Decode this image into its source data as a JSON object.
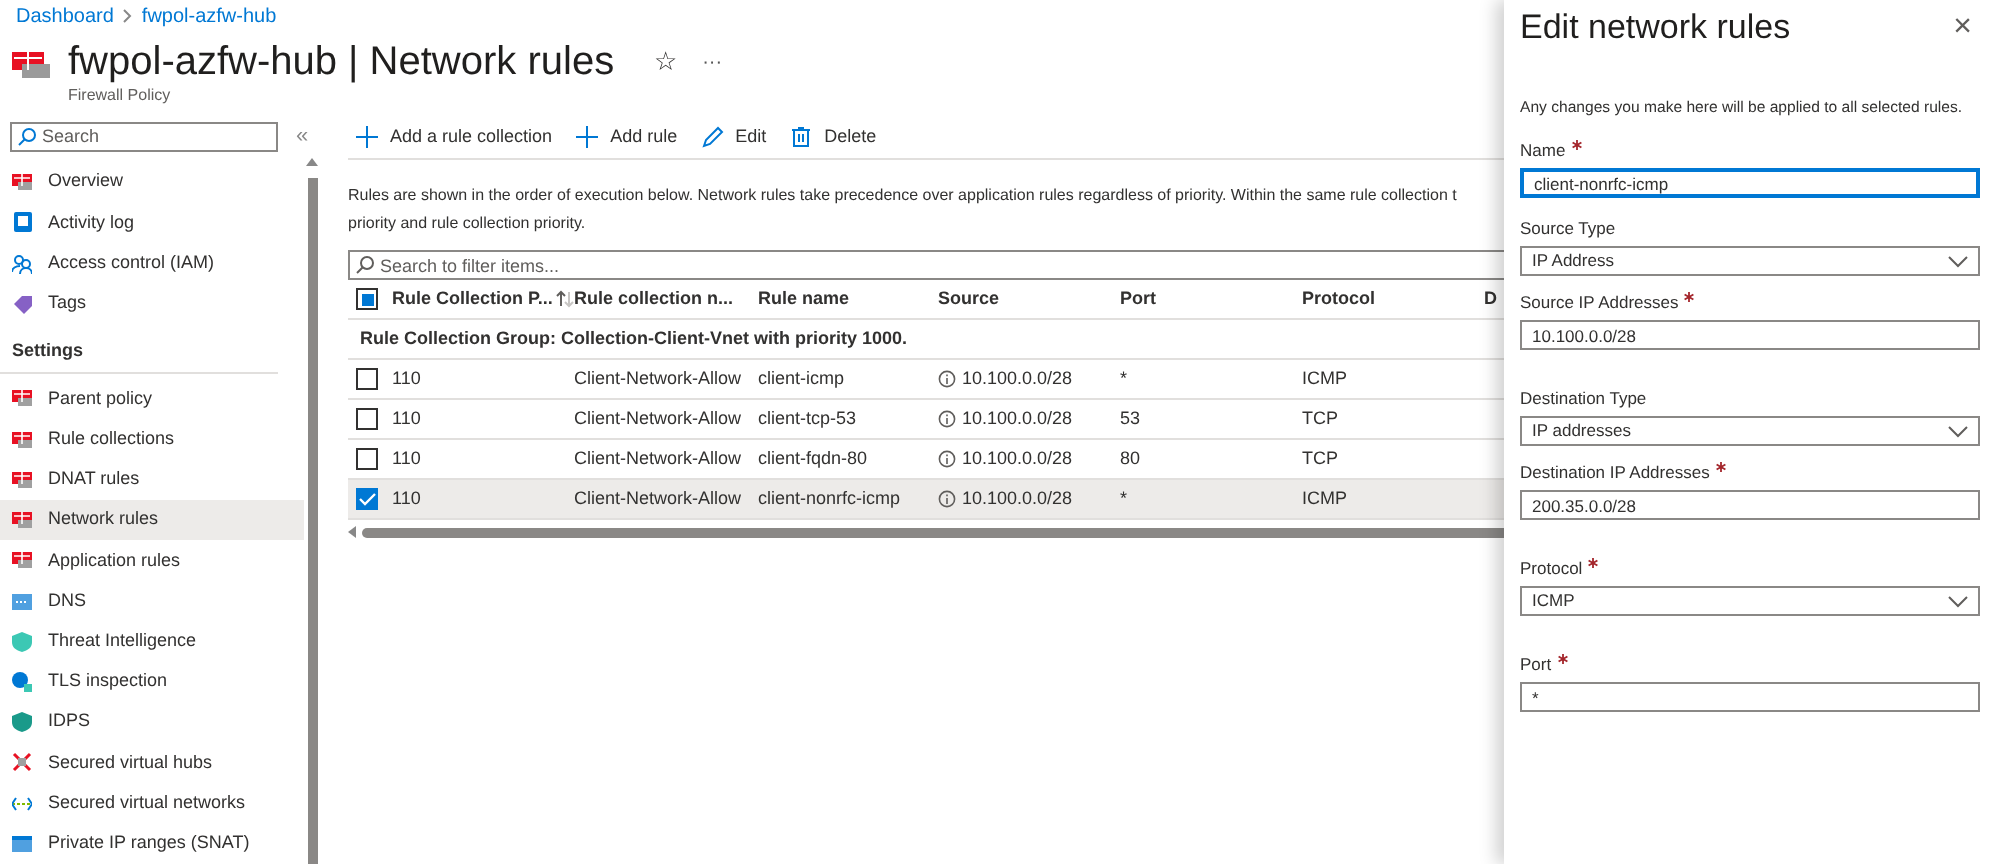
{
  "breadcrumb": [
    "Dashboard",
    "fwpol-azfw-hub"
  ],
  "header": {
    "title": "fwpol-azfw-hub | Network rules",
    "subtitle": "Firewall Policy",
    "favorite_icon": "☆",
    "more": "···"
  },
  "sidebar": {
    "search_placeholder": "Search",
    "collapse": "«",
    "items": [
      {
        "label": "Overview",
        "selected": false
      },
      {
        "label": "Activity log",
        "selected": false
      },
      {
        "label": "Access control (IAM)",
        "selected": false
      },
      {
        "label": "Tags",
        "selected": false
      }
    ],
    "section": "Settings",
    "settings_items": [
      {
        "label": "Parent policy",
        "selected": false
      },
      {
        "label": "Rule collections",
        "selected": false
      },
      {
        "label": "DNAT rules",
        "selected": false
      },
      {
        "label": "Network rules",
        "selected": true
      },
      {
        "label": "Application rules",
        "selected": false
      },
      {
        "label": "DNS",
        "selected": false
      },
      {
        "label": "Threat Intelligence",
        "selected": false
      },
      {
        "label": "TLS inspection",
        "selected": false
      },
      {
        "label": "IDPS",
        "selected": false
      },
      {
        "label": "Secured virtual hubs",
        "selected": false
      },
      {
        "label": "Secured virtual networks",
        "selected": false
      },
      {
        "label": "Private IP ranges (SNAT)",
        "selected": false
      }
    ]
  },
  "toolbar": [
    "Add a rule collection",
    "Add rule",
    "Edit",
    "Delete"
  ],
  "description_lines": [
    "Rules are shown in the order of execution below. Network rules take precedence over application rules regardless of priority. Within the same rule collection t",
    "priority and rule collection priority."
  ],
  "filter_placeholder": "Search to filter items...",
  "table": {
    "select_all_checked": true,
    "columns": [
      "Rule Collection P...",
      "Rule collection n...",
      "Rule name",
      "Source",
      "Port",
      "Protocol",
      "D"
    ],
    "group": "Rule Collection Group: Collection-Client-Vnet with priority 1000.",
    "rows": [
      {
        "checked": false,
        "cells": [
          "110",
          "Client-Network-Allow",
          "client-icmp",
          "10.100.0.0/28",
          "*",
          "ICMP"
        ]
      },
      {
        "checked": false,
        "cells": [
          "110",
          "Client-Network-Allow",
          "client-tcp-53",
          "10.100.0.0/28",
          "53",
          "TCP"
        ]
      },
      {
        "checked": false,
        "cells": [
          "110",
          "Client-Network-Allow",
          "client-fqdn-80",
          "10.100.0.0/28",
          "80",
          "TCP"
        ]
      },
      {
        "checked": true,
        "cells": [
          "110",
          "Client-Network-Allow",
          "client-nonrfc-icmp",
          "10.100.0.0/28",
          "*",
          "ICMP"
        ]
      }
    ]
  },
  "panel": {
    "title": "Edit network rules",
    "close": "×",
    "note": "Any changes you make here will be applied to all selected rules.",
    "fields": [
      {
        "kind": "text",
        "label": "Name",
        "required": true,
        "value": "client-nonrfc-icmp",
        "focused": true
      },
      {
        "kind": "select",
        "label": "Source Type",
        "required": false,
        "value": "IP Address",
        "focused": false
      },
      {
        "kind": "text",
        "label": "Source IP Addresses",
        "required": true,
        "value": "10.100.0.0/28",
        "focused": false
      },
      {
        "kind": "select",
        "label": "Destination Type",
        "required": false,
        "value": "IP addresses",
        "focused": false
      },
      {
        "kind": "text",
        "label": "Destination IP Addresses",
        "required": true,
        "value": "200.35.0.0/28",
        "focused": false
      },
      {
        "kind": "select",
        "label": "Protocol",
        "required": true,
        "value": "ICMP",
        "focused": false
      },
      {
        "kind": "text",
        "label": "Port",
        "required": true,
        "value": "*",
        "focused": false
      }
    ]
  }
}
